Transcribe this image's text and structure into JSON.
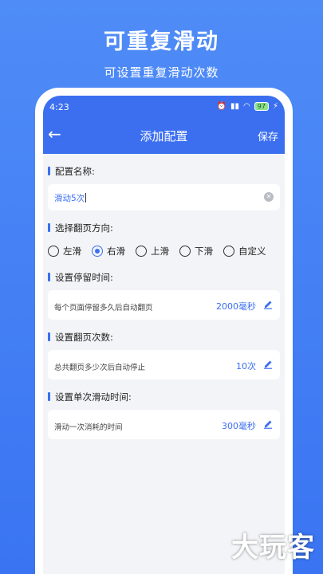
{
  "promo": {
    "title": "可重复滑动",
    "subtitle": "可设置重复滑动次数"
  },
  "status": {
    "time": "4:23",
    "battery": "97"
  },
  "navbar": {
    "title": "添加配置",
    "save_label": "保存"
  },
  "config_name": {
    "label": "配置名称:",
    "value": "滑动5次"
  },
  "direction": {
    "label": "选择翻页方向:",
    "options": [
      "左滑",
      "右滑",
      "上滑",
      "下滑",
      "自定义"
    ],
    "selected": "右滑"
  },
  "stay_time": {
    "label": "设置停留时间:",
    "desc": "每个页面停留多久后自动翻页",
    "value": "2000毫秒"
  },
  "page_count": {
    "label": "设置翻页次数:",
    "desc": "总共翻页多少次后自动停止",
    "value": "10次"
  },
  "swipe_time": {
    "label": "设置单次滑动时间:",
    "desc": "滑动一次消耗的时间",
    "value": "300毫秒"
  },
  "watermark": "大玩客",
  "colors": {
    "accent": "#3b6ff0",
    "background": "#4f8cf7"
  }
}
